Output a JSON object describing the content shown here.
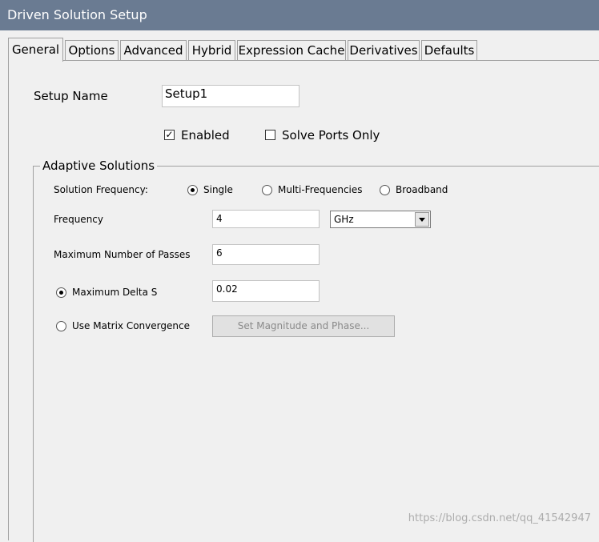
{
  "window": {
    "title": "Driven Solution Setup"
  },
  "tabs": [
    {
      "label": "General",
      "active": true
    },
    {
      "label": "Options"
    },
    {
      "label": "Advanced"
    },
    {
      "label": "Hybrid"
    },
    {
      "label": "Expression Cache"
    },
    {
      "label": "Derivatives"
    },
    {
      "label": "Defaults"
    }
  ],
  "general": {
    "setup_name_label": "Setup Name",
    "setup_name_value": "Setup1",
    "enabled_label": "Enabled",
    "enabled_checked": true,
    "solve_ports_label": "Solve Ports Only",
    "solve_ports_checked": false
  },
  "adaptive": {
    "group_title": "Adaptive Solutions",
    "solution_frequency_label": "Solution Frequency:",
    "freq_modes": [
      {
        "label": "Single",
        "selected": true
      },
      {
        "label": "Multi-Frequencies",
        "selected": false
      },
      {
        "label": "Broadband",
        "selected": false
      }
    ],
    "frequency_label": "Frequency",
    "frequency_value": "4",
    "frequency_unit": "GHz",
    "max_passes_label": "Maximum Number of Passes",
    "max_passes_value": "6",
    "max_delta_label": "Maximum Delta S",
    "max_delta_selected": true,
    "max_delta_value": "0.02",
    "matrix_conv_label": "Use Matrix Convergence",
    "matrix_conv_selected": false,
    "set_mag_phase_button": "Set Magnitude and Phase..."
  },
  "watermark": "https://blog.csdn.net/qq_41542947",
  "icons": {
    "checkmark": "check-icon",
    "dropdown": "chevron-down-icon"
  }
}
